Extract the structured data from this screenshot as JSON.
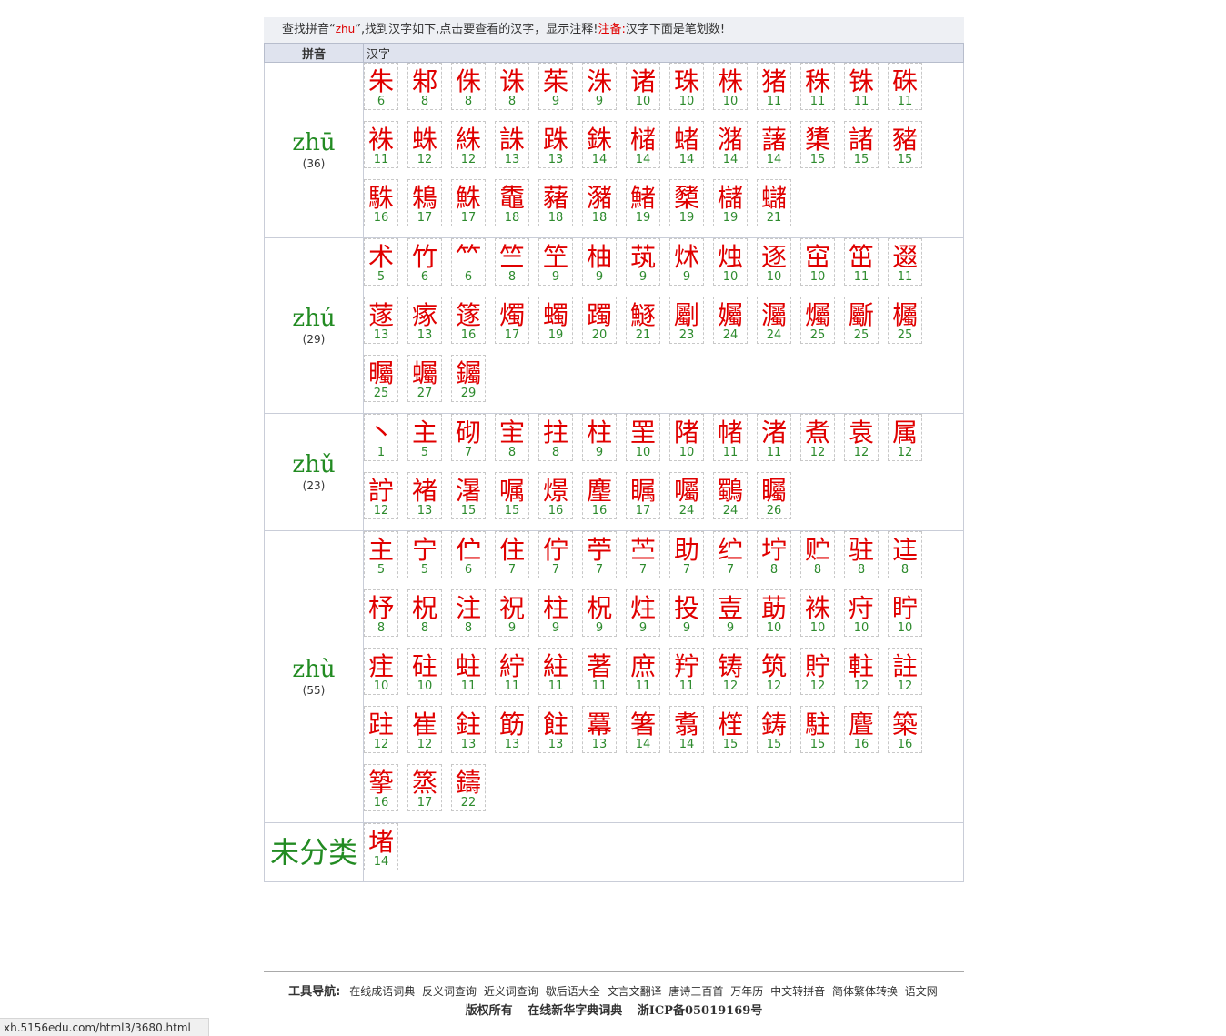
{
  "notice": {
    "prefix": "查找拼音“",
    "keyword": "zhu",
    "middle": "”,找到汉字如下,点击要查看的汉字，显示注释!",
    "note_label": "注备:",
    "note_text": "汉字下面是笔划数!"
  },
  "table": {
    "col_pinyin": "拼音",
    "col_hanzi": "汉字"
  },
  "groups": [
    {
      "pinyin": "zhū",
      "count": "(36)",
      "chars": [
        [
          "朱",
          "6"
        ],
        [
          "邾",
          "8"
        ],
        [
          "侏",
          "8"
        ],
        [
          "诛",
          "8"
        ],
        [
          "茱",
          "9"
        ],
        [
          "洙",
          "9"
        ],
        [
          "诸",
          "10"
        ],
        [
          "珠",
          "10"
        ],
        [
          "株",
          "10"
        ],
        [
          "猪",
          "11"
        ],
        [
          "秼",
          "11"
        ],
        [
          "铢",
          "11"
        ],
        [
          "硃",
          "11"
        ],
        [
          "袾",
          "11"
        ],
        [
          "蛛",
          "12"
        ],
        [
          "絑",
          "12"
        ],
        [
          "誅",
          "13"
        ],
        [
          "跦",
          "13"
        ],
        [
          "銖",
          "14"
        ],
        [
          "槠",
          "14"
        ],
        [
          "蝫",
          "14"
        ],
        [
          "潴",
          "14"
        ],
        [
          "藷",
          "14"
        ],
        [
          "橥",
          "15"
        ],
        [
          "諸",
          "15"
        ],
        [
          "豬",
          "15"
        ],
        [
          "駯",
          "16"
        ],
        [
          "鴸",
          "17"
        ],
        [
          "鮢",
          "17"
        ],
        [
          "鼄",
          "18"
        ],
        [
          "藸",
          "18"
        ],
        [
          "瀦",
          "18"
        ],
        [
          "鯺",
          "19"
        ],
        [
          "櫫",
          "19"
        ],
        [
          "櫧",
          "19"
        ],
        [
          "蠩",
          "21"
        ]
      ]
    },
    {
      "pinyin": "zhú",
      "count": "(29)",
      "chars": [
        [
          "术",
          "5"
        ],
        [
          "竹",
          "6"
        ],
        [
          "⺮",
          "6"
        ],
        [
          "竺",
          "8"
        ],
        [
          "笁",
          "9"
        ],
        [
          "柚",
          "9"
        ],
        [
          "茿",
          "9"
        ],
        [
          "炢",
          "9"
        ],
        [
          "烛",
          "10"
        ],
        [
          "逐",
          "10"
        ],
        [
          "窋",
          "10"
        ],
        [
          "笜",
          "11"
        ],
        [
          "逫",
          "11"
        ],
        [
          "蓫",
          "13"
        ],
        [
          "瘃",
          "13"
        ],
        [
          "篴",
          "16"
        ],
        [
          "燭",
          "17"
        ],
        [
          "蠋",
          "19"
        ],
        [
          "躅",
          "20"
        ],
        [
          "鱁",
          "21"
        ],
        [
          "劚",
          "23"
        ],
        [
          "孎",
          "24"
        ],
        [
          "灟",
          "24"
        ],
        [
          "爥",
          "25"
        ],
        [
          "斸",
          "25"
        ],
        [
          "欘",
          "25"
        ],
        [
          "曯",
          "25"
        ],
        [
          "蠾",
          "27"
        ],
        [
          "钃",
          "29"
        ]
      ]
    },
    {
      "pinyin": "zhǔ",
      "count": "(23)",
      "chars": [
        [
          "丶",
          "1"
        ],
        [
          "主",
          "5"
        ],
        [
          "砌",
          "7"
        ],
        [
          "宔",
          "8"
        ],
        [
          "拄",
          "8"
        ],
        [
          "柱",
          "9"
        ],
        [
          "罜",
          "10"
        ],
        [
          "陼",
          "10"
        ],
        [
          "帾",
          "11"
        ],
        [
          "渚",
          "11"
        ],
        [
          "煮",
          "12"
        ],
        [
          "袁",
          "12"
        ],
        [
          "属",
          "12"
        ],
        [
          "詝",
          "12"
        ],
        [
          "褚",
          "13"
        ],
        [
          "濐",
          "15"
        ],
        [
          "嘱",
          "15"
        ],
        [
          "燝",
          "16"
        ],
        [
          "麈",
          "16"
        ],
        [
          "瞩",
          "17"
        ],
        [
          "囑",
          "24"
        ],
        [
          "鸀",
          "24"
        ],
        [
          "矚",
          "26"
        ]
      ]
    },
    {
      "pinyin": "zhù",
      "count": "(55)",
      "chars": [
        [
          "主",
          "5"
        ],
        [
          "宁",
          "5"
        ],
        [
          "伫",
          "6"
        ],
        [
          "住",
          "7"
        ],
        [
          "佇",
          "7"
        ],
        [
          "苧",
          "7"
        ],
        [
          "苎",
          "7"
        ],
        [
          "助",
          "7"
        ],
        [
          "纻",
          "7"
        ],
        [
          "坾",
          "8"
        ],
        [
          "贮",
          "8"
        ],
        [
          "驻",
          "8"
        ],
        [
          "迬",
          "8"
        ],
        [
          "杼",
          "8"
        ],
        [
          "柷",
          "8"
        ],
        [
          "注",
          "8"
        ],
        [
          "祝",
          "9"
        ],
        [
          "柱",
          "9"
        ],
        [
          "柷",
          "9"
        ],
        [
          "炷",
          "9"
        ],
        [
          "投",
          "9"
        ],
        [
          "壴",
          "9"
        ],
        [
          "莇",
          "10"
        ],
        [
          "袾",
          "10"
        ],
        [
          "疛",
          "10"
        ],
        [
          "眝",
          "10"
        ],
        [
          "疰",
          "10"
        ],
        [
          "砫",
          "10"
        ],
        [
          "蛀",
          "11"
        ],
        [
          "紵",
          "11"
        ],
        [
          "紸",
          "11"
        ],
        [
          "著",
          "11"
        ],
        [
          "庶",
          "11"
        ],
        [
          "羜",
          "11"
        ],
        [
          "铸",
          "12"
        ],
        [
          "筑",
          "12"
        ],
        [
          "貯",
          "12"
        ],
        [
          "軴",
          "12"
        ],
        [
          "註",
          "12"
        ],
        [
          "跓",
          "12"
        ],
        [
          "崔",
          "12"
        ],
        [
          "鉒",
          "13"
        ],
        [
          "筯",
          "13"
        ],
        [
          "飳",
          "13"
        ],
        [
          "羃",
          "13"
        ],
        [
          "箸",
          "14"
        ],
        [
          "翥",
          "14"
        ],
        [
          "樦",
          "15"
        ],
        [
          "鋳",
          "15"
        ],
        [
          "駐",
          "15"
        ],
        [
          "麆",
          "16"
        ],
        [
          "築",
          "16"
        ],
        [
          "篫",
          "16"
        ],
        [
          "篜",
          "17"
        ],
        [
          "鑄",
          "22"
        ]
      ]
    },
    {
      "category": "未分类",
      "chars": [
        [
          "堵",
          "14"
        ]
      ]
    }
  ],
  "footer": {
    "tools_label": "工具导航:",
    "tools": [
      "在线成语词典",
      "反义词查询",
      "近义词查询",
      "歇后语大全",
      "文言文翻译",
      "唐诗三百首",
      "万年历",
      "中文转拼音",
      "简体繁体转换",
      "语文网"
    ],
    "copyright": "版权所有",
    "site": "在线新华字典词典",
    "icp": "浙ICP备05019169号"
  },
  "statusbar": {
    "url": "xh.5156edu.com/html3/3680.html"
  }
}
